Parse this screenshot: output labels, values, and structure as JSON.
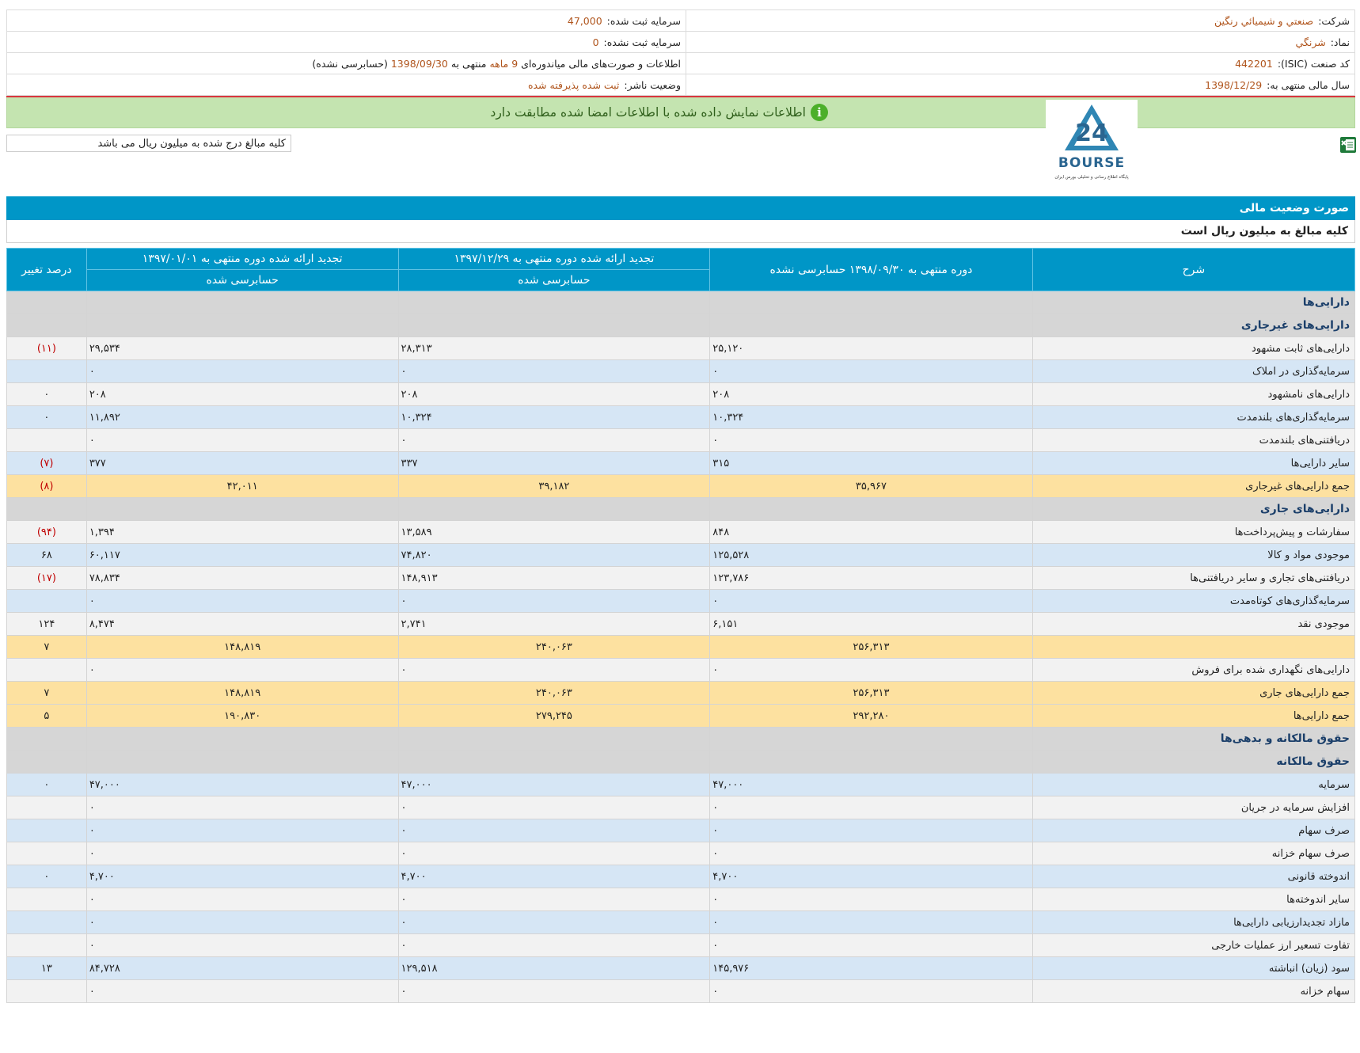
{
  "info": {
    "company_label": "شرکت:",
    "company_value": "صنعتي و شيميائي رنگين",
    "capital_label": "سرمایه ثبت شده:",
    "capital_value": "47,000",
    "symbol_label": "نماد:",
    "symbol_value": "شرنگي",
    "unregistered_label": "سرمایه ثبت نشده:",
    "unregistered_value": "0",
    "isic_label": "کد صنعت (ISIC):",
    "isic_value": "442201",
    "statement_pre": "اطلاعات و صورت‌های مالی میاندوره‌ای",
    "statement_months": "9 ماهه",
    "statement_mid": "منتهی به",
    "statement_date": "1398/09/30",
    "statement_post": "(حسابرسی نشده)",
    "fiscal_label": "سال مالی منتهی به:",
    "fiscal_value": "1398/12/29",
    "publisher_label": "وضعیت ناشر:",
    "publisher_value": "ثبت شده پذیرفته شده"
  },
  "banner": {
    "text": "اطلاعات نمایش داده شده با اطلاعات امضا شده مطابقت دارد"
  },
  "logo": {
    "word": "BOURSE",
    "sub": "پایگاه اطلاع رسانی و تحلیلی بورس ایران"
  },
  "amount_note": "کلیه مبالغ درج شده به میلیون ریال می باشد",
  "section_title": "صورت وضعیت مالی",
  "unit_text": "کلیه مبالغ به میلیون ریال است",
  "table": {
    "headers": {
      "desc": "شرح",
      "p1": "دوره منتهی به ۱۳۹۸/۰۹/۳۰ حسابرسی نشده",
      "p2": "تجدید ارائه شده دوره منتهی به ۱۳۹۷/۱۲/۲۹",
      "p2_sub": "حسابرسی شده",
      "p3": "تجدید ارائه شده دوره منتهی به ۱۳۹۷/۰۱/۰۱",
      "p3_sub": "حسابرسی شده",
      "pct": "درصد تغییر"
    },
    "rows": [
      {
        "type": "sec",
        "desc": "دارایی‌ها",
        "c1": "",
        "c2": "",
        "c3": "",
        "pct": ""
      },
      {
        "type": "sec",
        "desc": "دارایی‌های غیرجاری",
        "c1": "",
        "c2": "",
        "c3": "",
        "pct": ""
      },
      {
        "type": "white",
        "desc": "دارایی‌های ثابت مشهود",
        "c1": "۲۵,۱۲۰",
        "c2": "۲۸,۳۱۳",
        "c3": "۲۹,۵۳۴",
        "pct": "(۱۱)",
        "neg": true
      },
      {
        "type": "blue",
        "desc": "سرمایه‌گذاری در املاک",
        "c1": "۰",
        "c2": "۰",
        "c3": "۰",
        "pct": ""
      },
      {
        "type": "white",
        "desc": "دارایی‌های نامشهود",
        "c1": "۲۰۸",
        "c2": "۲۰۸",
        "c3": "۲۰۸",
        "pct": "۰"
      },
      {
        "type": "blue",
        "desc": "سرمایه‌گذاری‌های بلندمدت",
        "c1": "۱۰,۳۲۴",
        "c2": "۱۰,۳۲۴",
        "c3": "۱۱,۸۹۲",
        "pct": "۰"
      },
      {
        "type": "white",
        "desc": "دریافتنی‌های بلندمدت",
        "c1": "۰",
        "c2": "۰",
        "c3": "۰",
        "pct": ""
      },
      {
        "type": "blue",
        "desc": "سایر دارایی‌ها",
        "c1": "۳۱۵",
        "c2": "۳۳۷",
        "c3": "۳۷۷",
        "pct": "(۷)",
        "neg": true
      },
      {
        "type": "total",
        "desc": "جمع دارایی‌های غیرجاری",
        "c1": "۳۵,۹۶۷",
        "c2": "۳۹,۱۸۲",
        "c3": "۴۲,۰۱۱",
        "pct": "(۸)",
        "neg": true
      },
      {
        "type": "sec",
        "desc": "دارایی‌های جاری",
        "c1": "",
        "c2": "",
        "c3": "",
        "pct": ""
      },
      {
        "type": "white",
        "desc": "سفارشات و پیش‌پرداخت‌ها",
        "c1": "۸۴۸",
        "c2": "۱۳,۵۸۹",
        "c3": "۱,۳۹۴",
        "pct": "(۹۴)",
        "neg": true
      },
      {
        "type": "blue",
        "desc": "موجودی مواد و کالا",
        "c1": "۱۲۵,۵۲۸",
        "c2": "۷۴,۸۲۰",
        "c3": "۶۰,۱۱۷",
        "pct": "۶۸"
      },
      {
        "type": "white",
        "desc": "دریافتنی‌های تجاری و سایر دریافتنی‌ها",
        "c1": "۱۲۳,۷۸۶",
        "c2": "۱۴۸,۹۱۳",
        "c3": "۷۸,۸۳۴",
        "pct": "(۱۷)",
        "neg": true
      },
      {
        "type": "blue",
        "desc": "سرمایه‌گذاری‌های کوتاه‌مدت",
        "c1": "۰",
        "c2": "۰",
        "c3": "۰",
        "pct": ""
      },
      {
        "type": "white",
        "desc": "موجودی نقد",
        "c1": "۶,۱۵۱",
        "c2": "۲,۷۴۱",
        "c3": "۸,۴۷۴",
        "pct": "۱۲۴"
      },
      {
        "type": "total",
        "desc": "",
        "c1": "۲۵۶,۳۱۳",
        "c2": "۲۴۰,۰۶۳",
        "c3": "۱۴۸,۸۱۹",
        "pct": "۷"
      },
      {
        "type": "white",
        "desc": "دارایی‌های نگهداری شده برای فروش",
        "c1": "۰",
        "c2": "۰",
        "c3": "۰",
        "pct": ""
      },
      {
        "type": "total",
        "desc": "جمع دارایی‌های جاری",
        "c1": "۲۵۶,۳۱۳",
        "c2": "۲۴۰,۰۶۳",
        "c3": "۱۴۸,۸۱۹",
        "pct": "۷"
      },
      {
        "type": "total",
        "desc": "جمع دارایی‌ها",
        "c1": "۲۹۲,۲۸۰",
        "c2": "۲۷۹,۲۴۵",
        "c3": "۱۹۰,۸۳۰",
        "pct": "۵"
      },
      {
        "type": "sec",
        "desc": "حقوق مالکانه و بدهی‌ها",
        "c1": "",
        "c2": "",
        "c3": "",
        "pct": ""
      },
      {
        "type": "sec",
        "desc": "حقوق مالکانه",
        "c1": "",
        "c2": "",
        "c3": "",
        "pct": ""
      },
      {
        "type": "blue",
        "desc": "سرمایه",
        "c1": "۴۷,۰۰۰",
        "c2": "۴۷,۰۰۰",
        "c3": "۴۷,۰۰۰",
        "pct": "۰"
      },
      {
        "type": "white",
        "desc": "افزایش سرمایه در جریان",
        "c1": "۰",
        "c2": "۰",
        "c3": "۰",
        "pct": ""
      },
      {
        "type": "blue",
        "desc": "صرف سهام",
        "c1": "۰",
        "c2": "۰",
        "c3": "۰",
        "pct": ""
      },
      {
        "type": "white",
        "desc": "صرف سهام خزانه",
        "c1": "۰",
        "c2": "۰",
        "c3": "۰",
        "pct": ""
      },
      {
        "type": "blue",
        "desc": "اندوخته قانونی",
        "c1": "۴,۷۰۰",
        "c2": "۴,۷۰۰",
        "c3": "۴,۷۰۰",
        "pct": "۰"
      },
      {
        "type": "white",
        "desc": "سایر اندوخته‌ها",
        "c1": "۰",
        "c2": "۰",
        "c3": "۰",
        "pct": ""
      },
      {
        "type": "blue",
        "desc": "مازاد تجدیدارزیابی دارایی‌ها",
        "c1": "۰",
        "c2": "۰",
        "c3": "۰",
        "pct": ""
      },
      {
        "type": "white",
        "desc": "تفاوت تسعیر ارز عملیات خارجی",
        "c1": "۰",
        "c2": "۰",
        "c3": "۰",
        "pct": ""
      },
      {
        "type": "blue",
        "desc": "سود (زیان) انباشته",
        "c1": "۱۴۵,۹۷۶",
        "c2": "۱۲۹,۵۱۸",
        "c3": "۸۴,۷۲۸",
        "pct": "۱۳"
      },
      {
        "type": "white",
        "desc": "سهام خزانه",
        "c1": "۰",
        "c2": "۰",
        "c3": "۰",
        "pct": ""
      }
    ]
  }
}
